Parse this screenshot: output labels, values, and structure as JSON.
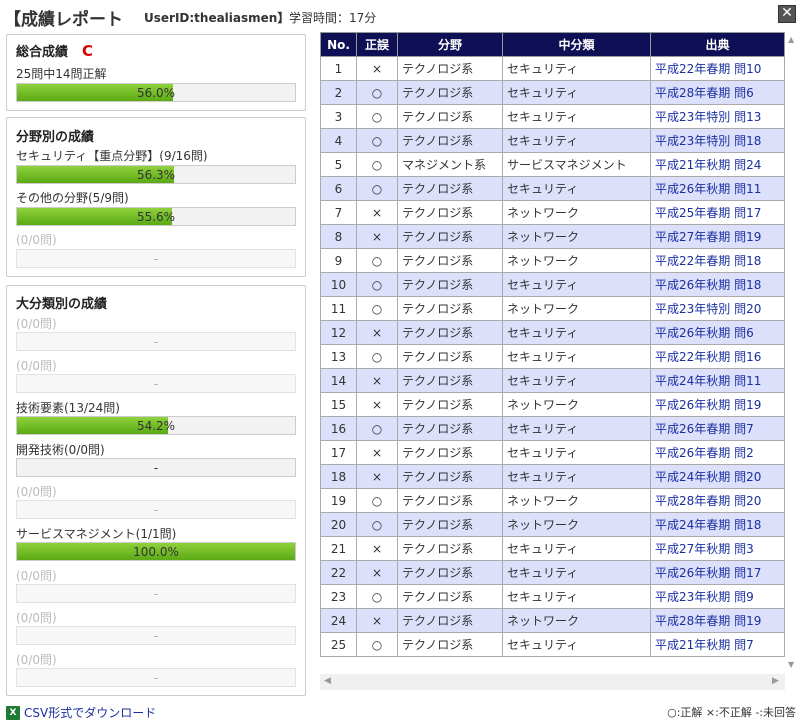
{
  "header": {
    "title": "【成績レポート",
    "userid": "UserID:thealiasmen】",
    "study_time": "学習時間：17分",
    "close_glyph": "✕"
  },
  "overall": {
    "title": "総合成績",
    "grade": "C",
    "summary": "25問中14問正解",
    "bar": {
      "text": "56.0%",
      "fraction": 0.56
    }
  },
  "field": {
    "title": "分野別の成績",
    "rows": [
      {
        "label": "セキュリティ【重点分野】(9/16問)",
        "bar_text": "56.3%",
        "fraction": 0.563,
        "empty": false
      },
      {
        "label": "その他の分野(5/9問)",
        "bar_text": "55.6%",
        "fraction": 0.556,
        "empty": false
      },
      {
        "label": "(0/0問)",
        "bar_text": "-",
        "fraction": 0,
        "empty": true
      }
    ]
  },
  "major": {
    "title": "大分類別の成績",
    "rows": [
      {
        "label": "(0/0問)",
        "bar_text": "-",
        "fraction": 0,
        "empty": true
      },
      {
        "label": "(0/0問)",
        "bar_text": "-",
        "fraction": 0,
        "empty": true
      },
      {
        "label": "技術要素(13/24問)",
        "bar_text": "54.2%",
        "fraction": 0.542,
        "empty": false
      },
      {
        "label": "開発技術(0/0問)",
        "bar_text": "-",
        "fraction": 0,
        "empty": false
      },
      {
        "label": "(0/0問)",
        "bar_text": "-",
        "fraction": 0,
        "empty": true
      },
      {
        "label": "サービスマネジメント(1/1問)",
        "bar_text": "100.0%",
        "fraction": 1.0,
        "empty": false
      },
      {
        "label": "(0/0問)",
        "bar_text": "-",
        "fraction": 0,
        "empty": true
      },
      {
        "label": "(0/0問)",
        "bar_text": "-",
        "fraction": 0,
        "empty": true
      },
      {
        "label": "(0/0問)",
        "bar_text": "-",
        "fraction": 0,
        "empty": true
      }
    ]
  },
  "table": {
    "headers": [
      "No.",
      "正誤",
      "分野",
      "中分類",
      "出典"
    ],
    "rows": [
      [
        "1",
        "×",
        "テクノロジ系",
        "セキュリティ",
        "平成22年春期 問10"
      ],
      [
        "2",
        "○",
        "テクノロジ系",
        "セキュリティ",
        "平成28年春期 問6"
      ],
      [
        "3",
        "○",
        "テクノロジ系",
        "セキュリティ",
        "平成23年特別 問13"
      ],
      [
        "4",
        "○",
        "テクノロジ系",
        "セキュリティ",
        "平成23年特別 問18"
      ],
      [
        "5",
        "○",
        "マネジメント系",
        "サービスマネジメント",
        "平成21年秋期 問24"
      ],
      [
        "6",
        "○",
        "テクノロジ系",
        "セキュリティ",
        "平成26年秋期 問11"
      ],
      [
        "7",
        "×",
        "テクノロジ系",
        "ネットワーク",
        "平成25年春期 問17"
      ],
      [
        "8",
        "×",
        "テクノロジ系",
        "ネットワーク",
        "平成27年春期 問19"
      ],
      [
        "9",
        "○",
        "テクノロジ系",
        "ネットワーク",
        "平成22年春期 問18"
      ],
      [
        "10",
        "○",
        "テクノロジ系",
        "セキュリティ",
        "平成26年秋期 問18"
      ],
      [
        "11",
        "○",
        "テクノロジ系",
        "ネットワーク",
        "平成23年特別 問20"
      ],
      [
        "12",
        "×",
        "テクノロジ系",
        "セキュリティ",
        "平成26年秋期 問6"
      ],
      [
        "13",
        "○",
        "テクノロジ系",
        "セキュリティ",
        "平成22年秋期 問16"
      ],
      [
        "14",
        "×",
        "テクノロジ系",
        "セキュリティ",
        "平成24年秋期 問11"
      ],
      [
        "15",
        "×",
        "テクノロジ系",
        "ネットワーク",
        "平成26年秋期 問19"
      ],
      [
        "16",
        "○",
        "テクノロジ系",
        "セキュリティ",
        "平成26年春期 問7"
      ],
      [
        "17",
        "×",
        "テクノロジ系",
        "セキュリティ",
        "平成26年春期 問2"
      ],
      [
        "18",
        "×",
        "テクノロジ系",
        "セキュリティ",
        "平成24年秋期 問20"
      ],
      [
        "19",
        "○",
        "テクノロジ系",
        "ネットワーク",
        "平成28年春期 問20"
      ],
      [
        "20",
        "○",
        "テクノロジ系",
        "ネットワーク",
        "平成24年春期 問18"
      ],
      [
        "21",
        "×",
        "テクノロジ系",
        "セキュリティ",
        "平成27年秋期 問3"
      ],
      [
        "22",
        "×",
        "テクノロジ系",
        "セキュリティ",
        "平成26年秋期 問17"
      ],
      [
        "23",
        "○",
        "テクノロジ系",
        "セキュリティ",
        "平成23年秋期 問9"
      ],
      [
        "24",
        "×",
        "テクノロジ系",
        "ネットワーク",
        "平成28年春期 問19"
      ],
      [
        "25",
        "○",
        "テクノロジ系",
        "セキュリティ",
        "平成21年秋期 問7"
      ]
    ]
  },
  "footer": {
    "csv_icon_label": "X",
    "csv_link": "CSV形式でダウンロード",
    "legend": "○:正解 ×:不正解 -:未回答"
  },
  "colors": {
    "header_bg": "#0f0f55",
    "row_alt": "#dde0fa",
    "bar_fill": "#6cbd1f",
    "grade": "#dd0000",
    "link": "#1a2fa0"
  }
}
